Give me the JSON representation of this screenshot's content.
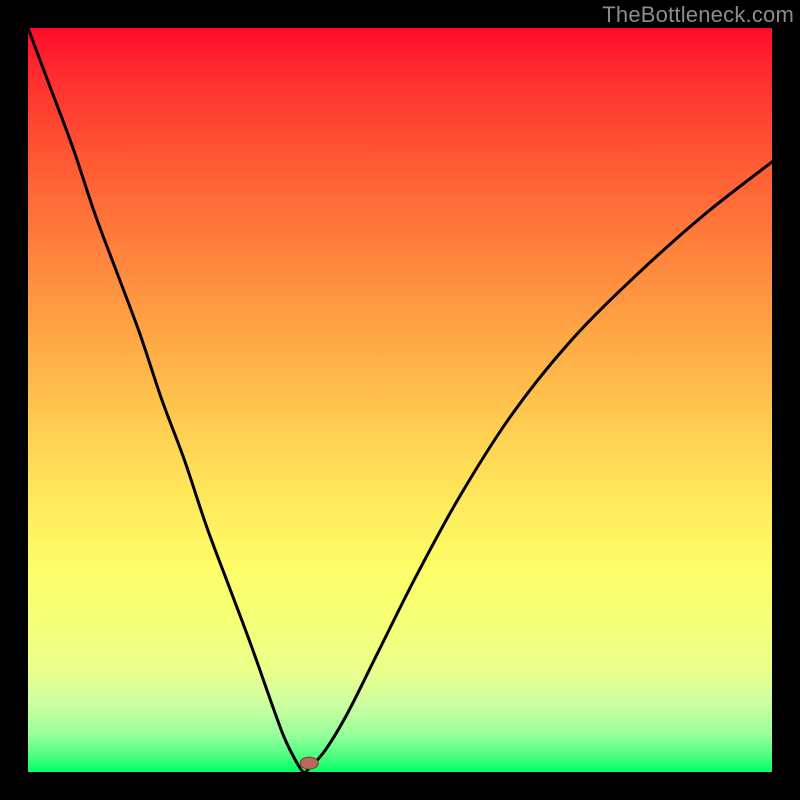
{
  "watermark": "TheBottleneck.com",
  "colors": {
    "frame": "#000000",
    "curve_stroke": "#000000",
    "marker_fill": "#b86a5f",
    "marker_stroke": "#7d3a32",
    "watermark": "#8c8c8c"
  },
  "chart_data": {
    "type": "line",
    "title": "",
    "xlabel": "",
    "ylabel": "",
    "xlim": [
      0,
      1
    ],
    "ylim": [
      0,
      1
    ],
    "note": "V-shaped bottleneck curve. y ≈ 1 at x=0, drops to 0 at x≈0.37, rises toward ~0.82 at x=1. Background color encodes y from red (high mismatch) to green (no bottleneck).",
    "background_scale": {
      "0.00": "#ff0a2a",
      "0.50": "#ffcb50",
      "0.75": "#fcfe68",
      "1.00": "#00ff63"
    },
    "x": [
      0.0,
      0.03,
      0.06,
      0.09,
      0.12,
      0.15,
      0.18,
      0.21,
      0.24,
      0.27,
      0.3,
      0.33,
      0.345,
      0.36,
      0.37,
      0.378,
      0.4,
      0.43,
      0.47,
      0.52,
      0.58,
      0.65,
      0.73,
      0.82,
      0.91,
      1.0
    ],
    "values": [
      1.0,
      0.92,
      0.84,
      0.75,
      0.67,
      0.59,
      0.5,
      0.42,
      0.33,
      0.25,
      0.17,
      0.085,
      0.045,
      0.015,
      0.0,
      0.005,
      0.03,
      0.08,
      0.16,
      0.26,
      0.37,
      0.48,
      0.58,
      0.67,
      0.75,
      0.82
    ],
    "marker": {
      "x": 0.378,
      "y": 0.012
    }
  }
}
